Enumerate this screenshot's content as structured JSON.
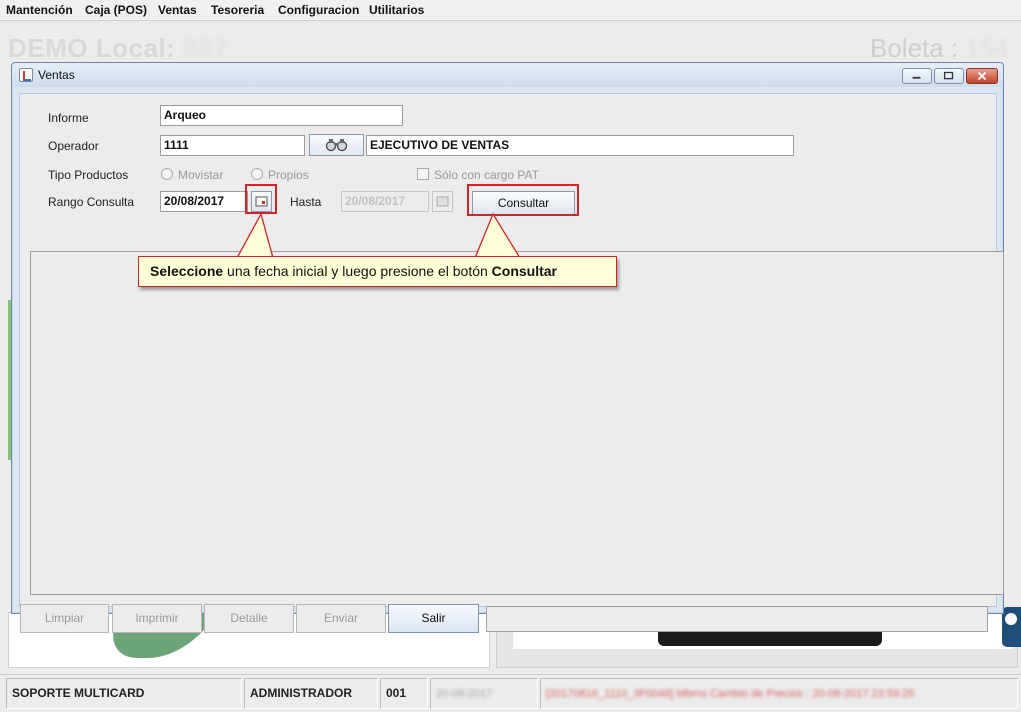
{
  "menubar": {
    "items": [
      "Mantención",
      "Caja (POS)",
      "Ventas",
      "Tesoreria",
      "Configuracion",
      "Utilitarios"
    ]
  },
  "background": {
    "title_left_label": "DEMO Local:",
    "title_left_value": "807",
    "title_right_label": "Boleta :",
    "title_right_value": "154"
  },
  "window": {
    "title": "Ventas",
    "form": {
      "informe_label": "Informe",
      "informe_value": "Arqueo",
      "operador_label": "Operador",
      "operador_code": "1111",
      "operador_name": "EJECUTIVO DE VENTAS",
      "tipo_productos_label": "Tipo Productos",
      "radio_movistar": "Movistar",
      "radio_propios": "Propios",
      "check_cargo_pat": "Sólo con cargo PAT",
      "rango_consulta_label": "Rango Consulta",
      "fecha_desde": "20/08/2017",
      "hasta_label": "Hasta",
      "fecha_hasta": "20/08/2017",
      "consultar_button": "Consultar"
    },
    "buttons": {
      "limpiar": "Limpiar",
      "imprimir": "Imprimir",
      "detalle": "Detalle",
      "enviar": "Enviar",
      "salir": "Salir"
    }
  },
  "callout": {
    "part1_bold": "Seleccione",
    "part2": " una fecha inicial y luego presione el botón ",
    "part3_bold": "Consultar"
  },
  "statusbar": {
    "soporte": "SOPORTE MULTICARD",
    "usuario": "ADMINISTRADOR",
    "codigo": "001",
    "fecha": "20-08-2017",
    "mensaje": "[20170816_1110_3F0048] Mbmo Cambio de Precios : 20-08-2017 23:59:25"
  },
  "colors": {
    "highlight": "#d2222a",
    "callout_bg": "#ffffd8"
  }
}
